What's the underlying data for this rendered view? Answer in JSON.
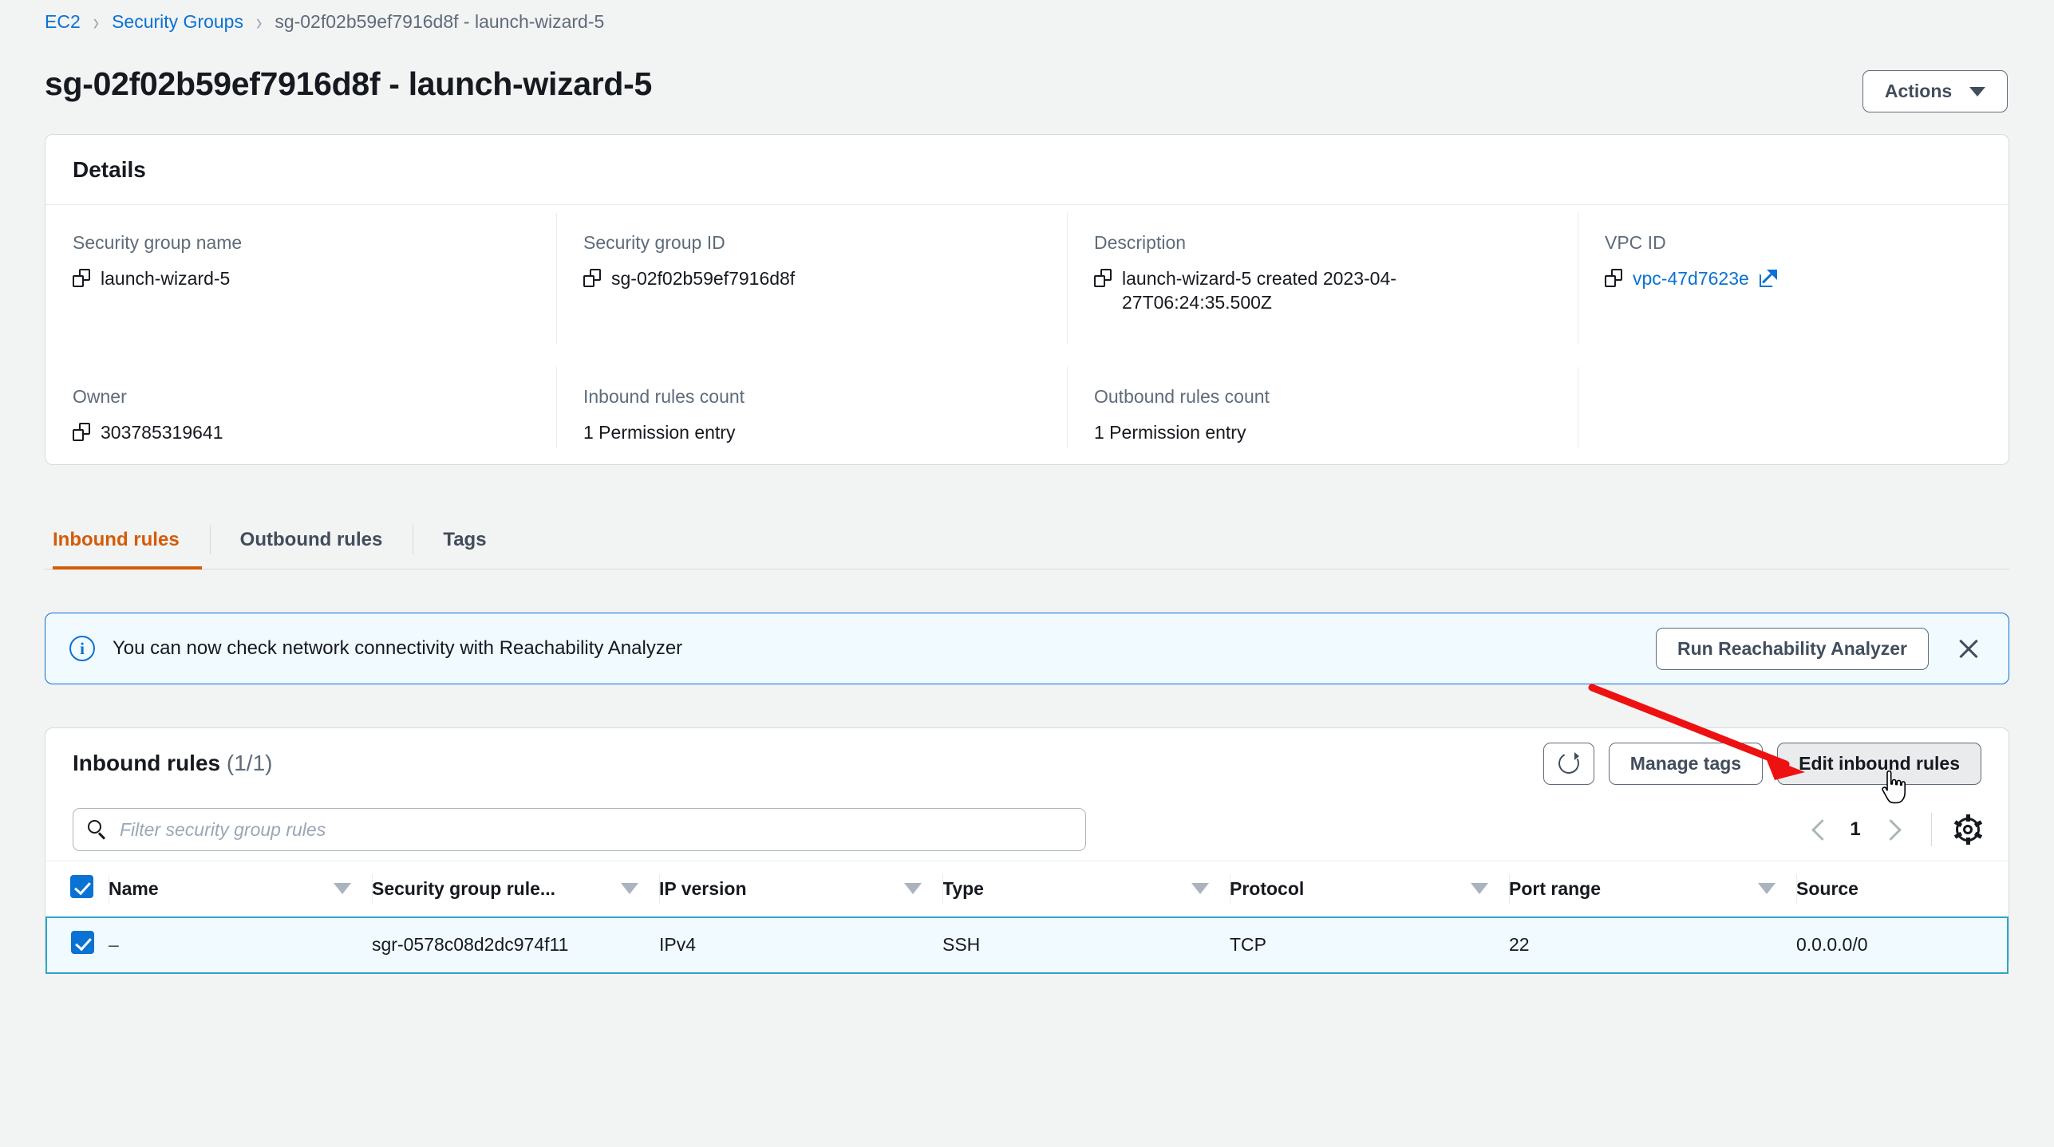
{
  "breadcrumb": {
    "items": [
      {
        "label": "EC2",
        "type": "link"
      },
      {
        "label": "Security Groups",
        "type": "link"
      },
      {
        "label": "sg-02f02b59ef7916d8f - launch-wizard-5",
        "type": "current"
      }
    ],
    "separator": "›"
  },
  "header": {
    "title": "sg-02f02b59ef7916d8f - launch-wizard-5",
    "actions_label": "Actions"
  },
  "details": {
    "panel_title": "Details",
    "fields": [
      {
        "label": "Security group name",
        "value": "launch-wizard-5",
        "icon": "copy-icon"
      },
      {
        "label": "Security group ID",
        "value": "sg-02f02b59ef7916d8f",
        "icon": "copy-icon"
      },
      {
        "label": "Description",
        "value": "launch-wizard-5 created 2023-04-27T06:24:35.500Z",
        "icon": "copy-icon"
      },
      {
        "label": "VPC ID",
        "value": "vpc-47d7623e",
        "icon": "copy-icon",
        "link": true,
        "external": true
      },
      {
        "label": "Owner",
        "value": "303785319641",
        "icon": "copy-icon"
      },
      {
        "label": "Inbound rules count",
        "value": "1 Permission entry"
      },
      {
        "label": "Outbound rules count",
        "value": "1 Permission entry"
      }
    ]
  },
  "tabs": [
    {
      "label": "Inbound rules",
      "active": true
    },
    {
      "label": "Outbound rules",
      "active": false
    },
    {
      "label": "Tags",
      "active": false
    }
  ],
  "banner": {
    "icon": "info-icon",
    "message": "You can now check network connectivity with Reachability Analyzer",
    "action_label": "Run Reachability Analyzer",
    "close_label": "×",
    "accent_color": "#0972d3",
    "background_color": "#f1faff"
  },
  "rules_panel": {
    "title": "Inbound rules",
    "count": "(1/1)",
    "refresh_icon": "refresh-icon",
    "manage_tags_label": "Manage tags",
    "edit_label": "Edit inbound rules",
    "search_placeholder": "Filter security group rules",
    "search_value": "",
    "pagination": {
      "prev": "‹",
      "page": "1",
      "next": "›"
    },
    "settings_icon": "gear-icon",
    "columns": [
      {
        "label": "Name",
        "sortable": true
      },
      {
        "label": "Security group rule...",
        "sortable": true
      },
      {
        "label": "IP version",
        "sortable": true
      },
      {
        "label": "Type",
        "sortable": true
      },
      {
        "label": "Protocol",
        "sortable": true
      },
      {
        "label": "Port range",
        "sortable": true
      },
      {
        "label": "Source",
        "sortable": false
      }
    ],
    "rows": [
      {
        "selected": true,
        "name": "–",
        "rule_id": "sgr-0578c08d2dc974f11",
        "ip_version": "IPv4",
        "type": "SSH",
        "protocol": "TCP",
        "port_range": "22",
        "source": "0.0.0.0/0"
      }
    ]
  },
  "annotation": {
    "arrow_color": "#ee1111",
    "points_to": "Edit inbound rules"
  },
  "colors": {
    "accent_blue": "#0972d3",
    "active_tab_orange": "#d45b07",
    "page_background": "#f2f3f3",
    "selected_row_border": "#2ea6c4"
  }
}
